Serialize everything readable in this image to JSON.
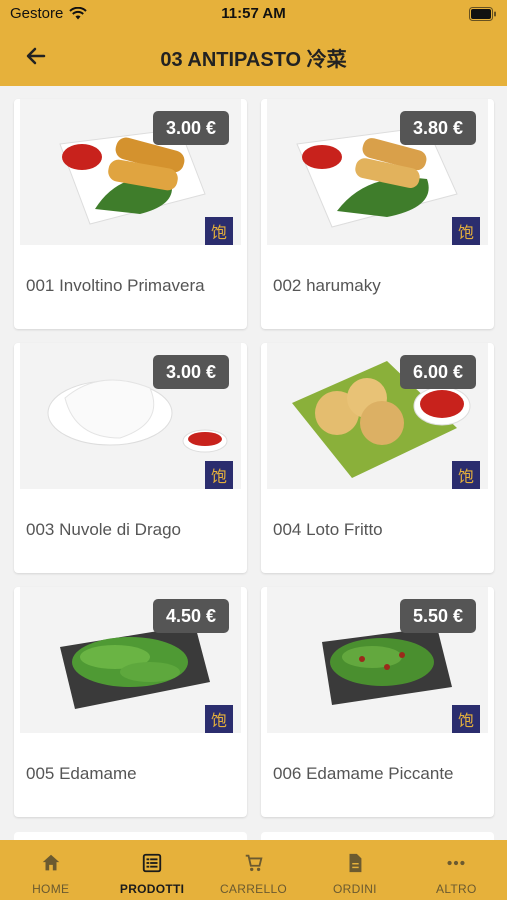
{
  "status_bar": {
    "carrier": "Gestore",
    "time": "11:57 AM"
  },
  "nav": {
    "title": "03 ANTIPASTO 冷菜"
  },
  "products": [
    {
      "name": "001 Involtino Primavera",
      "price": "3.00 €"
    },
    {
      "name": "002 harumaky",
      "price": "3.80 €"
    },
    {
      "name": "003 Nuvole di Drago",
      "price": "3.00 €"
    },
    {
      "name": "004 Loto Fritto",
      "price": "6.00 €"
    },
    {
      "name": "005 Edamame",
      "price": "4.50 €"
    },
    {
      "name": "006 Edamame Piccante",
      "price": "5.50 €"
    }
  ],
  "brand_logo_glyph": "饱",
  "tabs": [
    {
      "label": "HOME",
      "icon": "home-icon"
    },
    {
      "label": "PRODOTTI",
      "icon": "list-icon"
    },
    {
      "label": "CARRELLO",
      "icon": "cart-icon"
    },
    {
      "label": "ORDINI",
      "icon": "document-icon"
    },
    {
      "label": "ALTRO",
      "icon": "more-icon"
    }
  ],
  "colors": {
    "accent": "#e6b13b",
    "price_badge": "#555555",
    "logo_bg": "#2b2d6e"
  }
}
